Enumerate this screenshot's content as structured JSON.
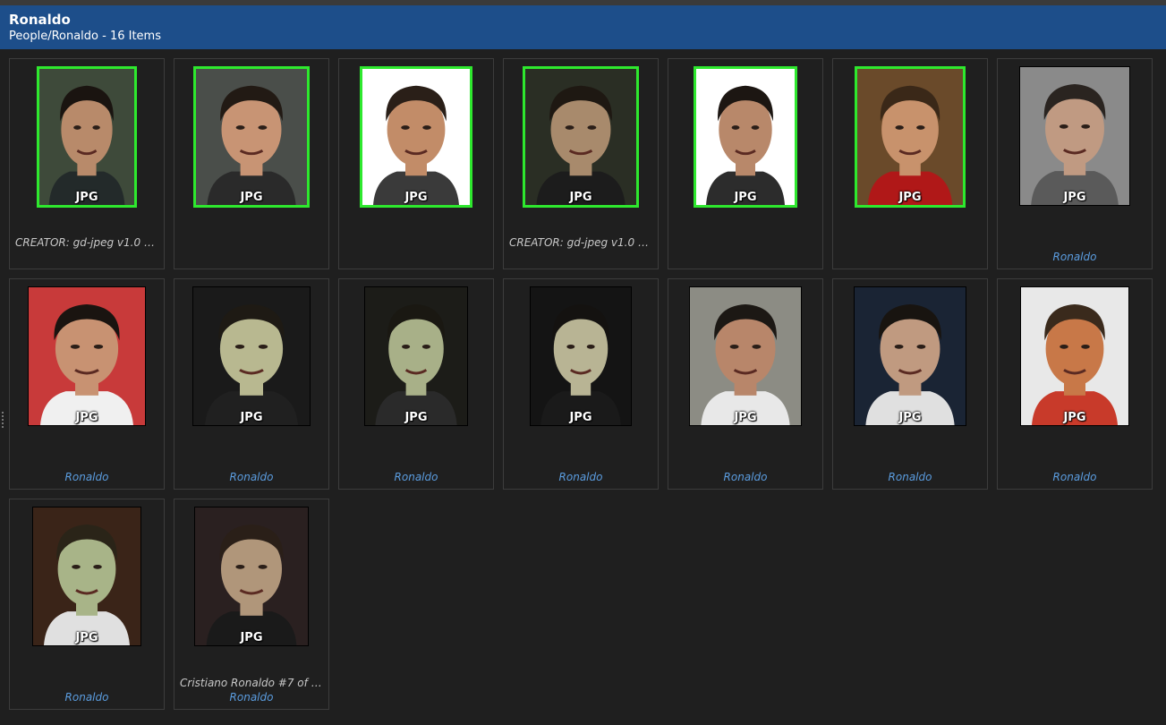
{
  "header": {
    "title": "Ronaldo",
    "subtitle": "People/Ronaldo - 16 Items"
  },
  "items": [
    {
      "badge": "JPG",
      "selected": true,
      "meta": "CREATOR: gd-jpeg v1.0 (us…",
      "tag": "",
      "bg": "#3e4a3a",
      "skin": "#b88a6a",
      "hair": "#1a1410",
      "shirt": "#232a2a"
    },
    {
      "badge": "JPG",
      "selected": true,
      "meta": "",
      "tag": "",
      "bg": "#4a4e4a",
      "skin": "#c89474",
      "hair": "#221a14",
      "shirt": "#2a2a2a"
    },
    {
      "badge": "JPG",
      "selected": true,
      "meta": "",
      "tag": "",
      "bg": "#ffffff",
      "skin": "#c28c68",
      "hair": "#2a1f18",
      "shirt": "#3a3a3a"
    },
    {
      "badge": "JPG",
      "selected": true,
      "meta": "CREATOR: gd-jpeg v1.0 (us…",
      "tag": "",
      "bg": "#2a2e24",
      "skin": "#a88a6c",
      "hair": "#1e1812",
      "shirt": "#1c1c1c"
    },
    {
      "badge": "JPG",
      "selected": true,
      "meta": "",
      "tag": "",
      "bg": "#ffffff",
      "skin": "#b8886a",
      "hair": "#1c1612",
      "shirt": "#2c2c2c"
    },
    {
      "badge": "JPG",
      "selected": true,
      "meta": "",
      "tag": "",
      "bg": "#6a4a2a",
      "skin": "#c8926c",
      "hair": "#3a2818",
      "shirt": "#b01818"
    },
    {
      "badge": "JPG",
      "selected": false,
      "meta": "",
      "tag": "Ronaldo",
      "bg": "#8a8a8a",
      "skin": "#c09a82",
      "hair": "#2a2420",
      "shirt": "#5a5a5a"
    },
    {
      "badge": "JPG",
      "selected": false,
      "meta": "",
      "tag": "Ronaldo",
      "bg": "#c83a3a",
      "skin": "#c89272",
      "hair": "#1a1410",
      "shirt": "#f0f0f0"
    },
    {
      "badge": "JPG",
      "selected": false,
      "meta": "",
      "tag": "Ronaldo",
      "bg": "#1a1a1a",
      "skin": "#b8b890",
      "hair": "#1e1a14",
      "shirt": "#202020"
    },
    {
      "badge": "JPG",
      "selected": false,
      "meta": "",
      "tag": "Ronaldo",
      "bg": "#1c1c18",
      "skin": "#a8b088",
      "hair": "#1a1812",
      "shirt": "#2a2a2a"
    },
    {
      "badge": "JPG",
      "selected": false,
      "meta": "",
      "tag": "Ronaldo",
      "bg": "#141414",
      "skin": "#b8b494",
      "hair": "#141210",
      "shirt": "#1a1a1a"
    },
    {
      "badge": "JPG",
      "selected": false,
      "meta": "",
      "tag": "Ronaldo",
      "bg": "#8c8c84",
      "skin": "#b8866a",
      "hair": "#1c1814",
      "shirt": "#e8e8e8"
    },
    {
      "badge": "JPG",
      "selected": false,
      "meta": "",
      "tag": "Ronaldo",
      "bg": "#1a2434",
      "skin": "#c09a80",
      "hair": "#181410",
      "shirt": "#e0e0e0"
    },
    {
      "badge": "JPG",
      "selected": false,
      "meta": "",
      "tag": "Ronaldo",
      "bg": "#e8e8e8",
      "skin": "#c87848",
      "hair": "#3a2a1c",
      "shirt": "#c83a2a"
    },
    {
      "badge": "JPG",
      "selected": false,
      "meta": "",
      "tag": "Ronaldo",
      "bg": "#3a2418",
      "skin": "#a8b488",
      "hair": "#2a2418",
      "shirt": "#e0e0e0"
    },
    {
      "badge": "JPG",
      "selected": false,
      "meta": "Cristiano Ronaldo #7 of J…",
      "tag": "Ronaldo",
      "bg": "#2a2020",
      "skin": "#b0967a",
      "hair": "#2a1f18",
      "shirt": "#1a1a1a"
    }
  ]
}
